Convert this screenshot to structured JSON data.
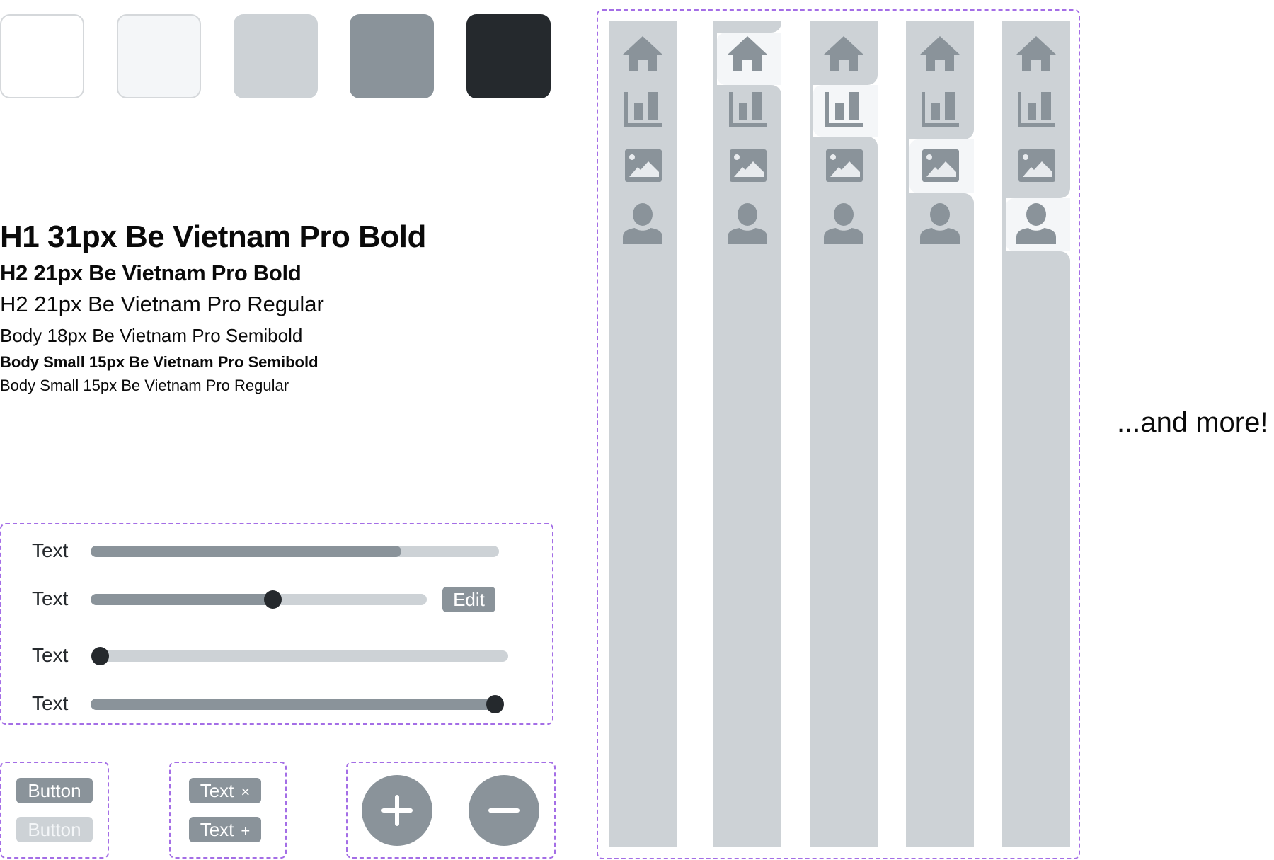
{
  "palette": {
    "swatches": [
      {
        "name": "white",
        "color": "#ffffff",
        "bordered": true
      },
      {
        "name": "off-white",
        "color": "#f4f6f8",
        "bordered": true
      },
      {
        "name": "light-gray",
        "color": "#cdd2d6",
        "bordered": false
      },
      {
        "name": "mid-gray",
        "color": "#8a939a",
        "bordered": false
      },
      {
        "name": "dark",
        "color": "#25292d",
        "bordered": false
      }
    ],
    "accent_dashed": "#a46ee6"
  },
  "typography": {
    "h1": "H1 31px Be Vietnam Pro Bold",
    "h2_bold": "H2 21px Be Vietnam Pro Bold",
    "h2_regular": "H2 21px Be Vietnam Pro Regular",
    "body": "Body 18px Be Vietnam Pro Semibold",
    "body_small_semibold": "Body Small 15px Be Vietnam Pro Semibold",
    "body_small_regular": "Body Small 15px Be Vietnam Pro Regular"
  },
  "sliders": {
    "rows": [
      {
        "label": "Text",
        "value": 0.76,
        "type": "progress"
      },
      {
        "label": "Text",
        "value": 0.54,
        "type": "slider"
      },
      {
        "label": "Text",
        "value": 0.0,
        "type": "slider"
      },
      {
        "label": "Text",
        "value": 1.0,
        "type": "slider"
      }
    ],
    "edit_label": "Edit"
  },
  "buttons": {
    "primary_label": "Button",
    "disabled_label": "Button"
  },
  "chips": [
    {
      "label": "Text",
      "symbol": "×",
      "action": "remove"
    },
    {
      "label": "Text",
      "symbol": "+",
      "action": "add"
    }
  ],
  "round_buttons": [
    {
      "name": "add",
      "icon": "plus-icon"
    },
    {
      "name": "remove",
      "icon": "minus-icon"
    }
  ],
  "sidebar_variants": {
    "items": [
      "home-icon",
      "chart-icon",
      "image-icon",
      "user-icon"
    ],
    "active_index_per_variant": [
      null,
      0,
      1,
      2,
      3
    ]
  },
  "more_text": "...and more!"
}
